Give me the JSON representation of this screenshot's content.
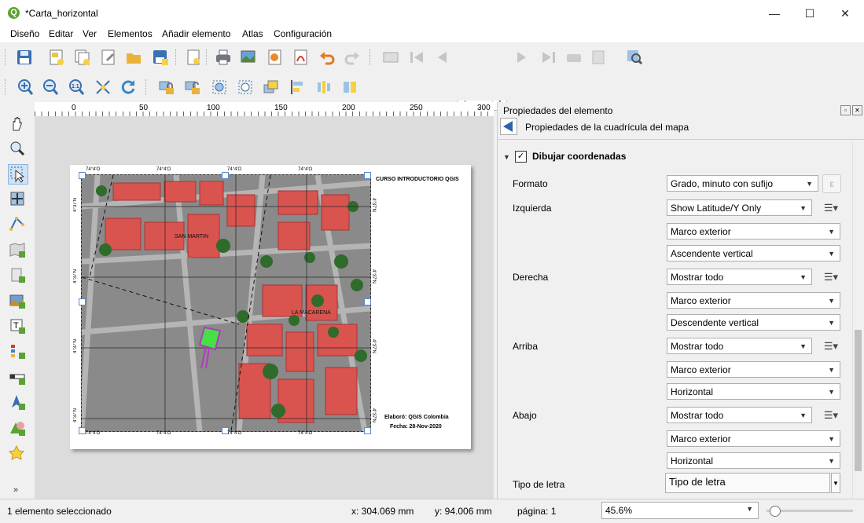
{
  "window": {
    "title": "*Carta_horizontal",
    "minimize": "—",
    "maximize": "☐",
    "close": "✕"
  },
  "menu": [
    "Diseño",
    "Editar",
    "Ver",
    "Elementos",
    "Añadir elemento",
    "Atlas",
    "Configuración"
  ],
  "toolbar": {
    "page_field_value": "1"
  },
  "rulers": {
    "horizontal": [
      "0",
      "50",
      "100",
      "150",
      "200",
      "250",
      "300"
    ],
    "vertical": [
      "0",
      "50",
      "100",
      "150",
      "200"
    ]
  },
  "layout_page": {
    "title_text": "CURSO INTRODUCTORIO QGIS",
    "credit_line1": "Elaboró: QGIS Colombia",
    "credit_line2": "Fecha: 28-Nov-2020",
    "top_coords": [
      "74°4'O",
      "74°4'O",
      "74°4'O",
      "74°4'O"
    ],
    "bottom_coords": [
      "74°4'O",
      "74°4'O",
      "74°4'O",
      "74°4'O"
    ],
    "left_coords": [
      "4°37'N",
      "4°37'N",
      "4°37'N",
      "4°37'N"
    ],
    "right_coords": [
      "4°37'N",
      "4°37'N",
      "4°37'N",
      "4°37'N"
    ],
    "neighborhood_1": "SAN MARTIN",
    "neighborhood_2": "LA MACARENA"
  },
  "panel": {
    "header": "Propiedades del elemento",
    "subheader": "Propiedades de la cuadrícula del mapa",
    "section_title": "Dibujar coordenadas",
    "section_checked": true,
    "formato_label": "Formato",
    "formato_value": "Grado, minuto con sufijo",
    "izquierda_label": "Izquierda",
    "izquierda_values": [
      "Show Latitude/Y Only",
      "Marco exterior",
      "Ascendente vertical"
    ],
    "derecha_label": "Derecha",
    "derecha_values": [
      "Mostrar todo",
      "Marco exterior",
      "Descendente vertical"
    ],
    "arriba_label": "Arriba",
    "arriba_values": [
      "Mostrar todo",
      "Marco exterior",
      "Horizontal"
    ],
    "abajo_label": "Abajo",
    "abajo_values": [
      "Mostrar todo",
      "Marco exterior",
      "Horizontal"
    ],
    "tipo_letra_label": "Tipo de letra",
    "tipo_letra_button": "Tipo de letra"
  },
  "statusbar": {
    "selection": "1 elemento seleccionado",
    "x": "x: 304.069 mm",
    "y": "y: 94.006 mm",
    "page": "página: 1",
    "zoom": "45.6%"
  }
}
